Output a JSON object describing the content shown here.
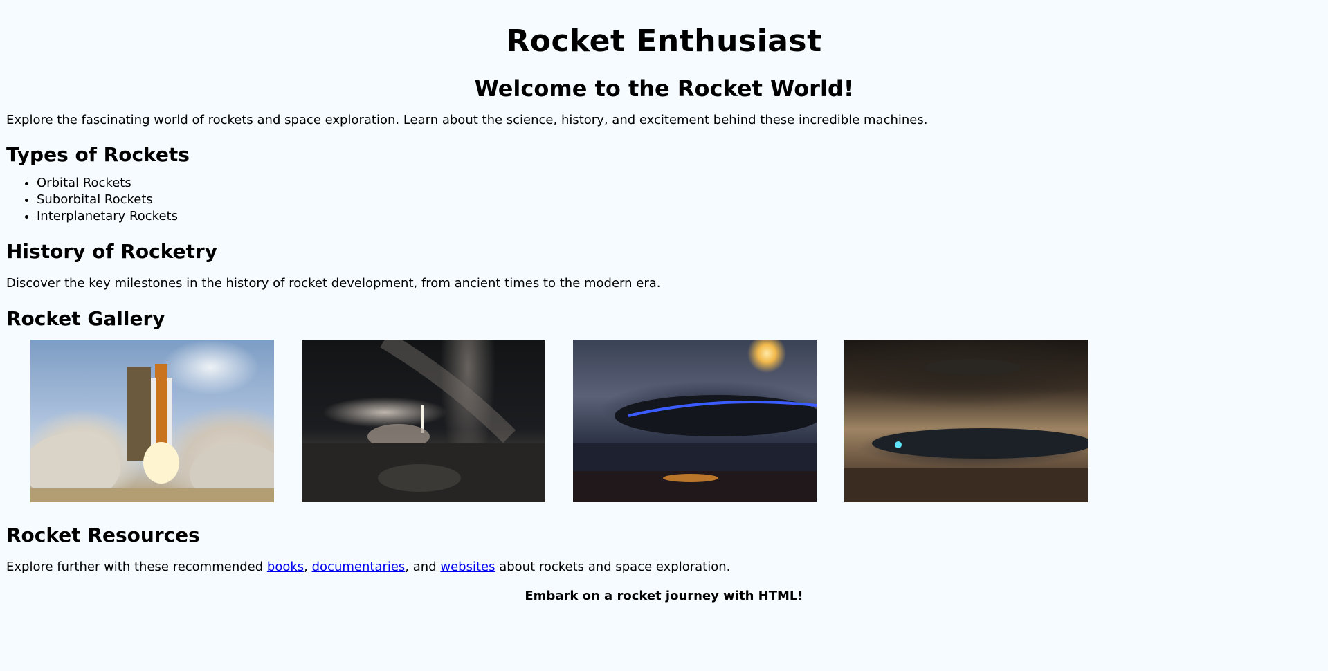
{
  "header": {
    "title": "Rocket Enthusiast",
    "welcome": "Welcome to the Rocket World!"
  },
  "intro": {
    "text": "Explore the fascinating world of rockets and space exploration. Learn about the science, history, and excitement behind these incredible machines."
  },
  "types": {
    "heading": "Types of Rockets",
    "items": [
      "Orbital Rockets",
      "Suborbital Rockets",
      "Interplanetary Rockets"
    ]
  },
  "history": {
    "heading": "History of Rocketry",
    "text": "Discover the key milestones in the history of rocket development, from ancient times to the modern era."
  },
  "gallery": {
    "heading": "Rocket Gallery"
  },
  "resources": {
    "heading": "Rocket Resources",
    "prefix": "Explore further with these recommended ",
    "link_books": "books",
    "sep1": ", ",
    "link_documentaries": "documentaries",
    "sep2": ", and ",
    "link_websites": "websites",
    "suffix": " about rockets and space exploration."
  },
  "footer": {
    "note": "Embark on a rocket journey with HTML!"
  },
  "colors": {
    "background": "#f5fbff",
    "link": "#0000ee"
  }
}
